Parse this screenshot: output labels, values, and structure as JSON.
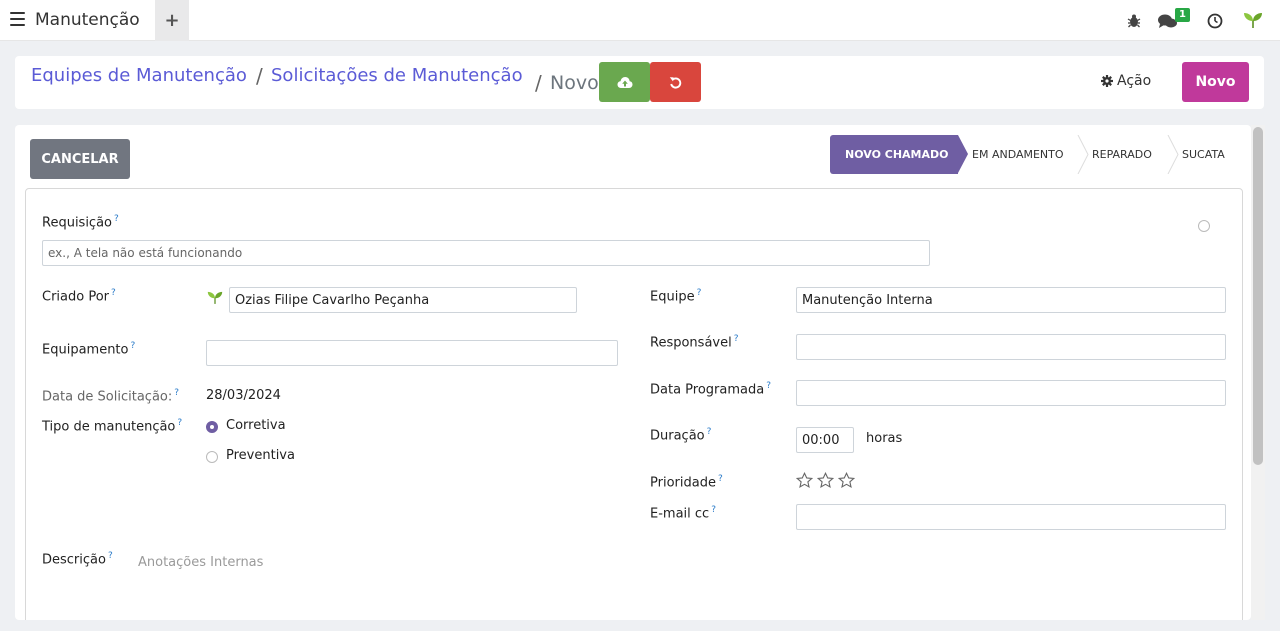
{
  "topbar": {
    "app_title": "Manutenção",
    "plus": "+",
    "chat_badge": "1"
  },
  "breadcrumb": {
    "item1": "Equipes de Manutenção",
    "sep": "/",
    "item2": "Solicitações de Manutenção",
    "current": "Novo"
  },
  "control_panel": {
    "acao_label": "Ação",
    "novo_label": "Novo"
  },
  "form": {
    "cancel_label": "CANCELAR",
    "stages": [
      "NOVO CHAMADO",
      "EM ANDAMENTO",
      "REPARADO",
      "SUCATA"
    ],
    "active_stage": "NOVO CHAMADO",
    "requisicao_label": "Requisição",
    "requisicao_placeholder": "ex., A tela não está funcionando",
    "criado_por_label": "Criado Por",
    "criado_por_value": "Ozias Filipe Cavarlho Peçanha",
    "equipamento_label": "Equipamento",
    "equipamento_value": "",
    "data_solicitacao_label": "Data de Solicitação:",
    "data_solicitacao_value": "28/03/2024",
    "tipo_label": "Tipo de manutenção",
    "tipo_options": [
      "Corretiva",
      "Preventiva"
    ],
    "tipo_selected": "Corretiva",
    "equipe_label": "Equipe",
    "equipe_value": "Manutenção Interna",
    "responsavel_label": "Responsável",
    "responsavel_value": "",
    "data_programada_label": "Data Programada",
    "data_programada_value": "",
    "duracao_label": "Duração",
    "duracao_value": "00:00",
    "duracao_unit": "horas",
    "prioridade_label": "Prioridade",
    "prioridade_stars": 0,
    "prioridade_max": 3,
    "email_cc_label": "E-mail cc",
    "email_cc_value": "",
    "descricao_label": "Descrição",
    "descricao_placeholder": "Anotações Internas",
    "help_mark": "?"
  },
  "colors": {
    "accent_purple": "#6f5ea3",
    "save_green": "#6aa84f",
    "discard_red": "#d9463d",
    "new_magenta": "#c0399b",
    "link_blue": "#5b5bd6"
  },
  "icons": [
    "menu-icon",
    "bug-icon",
    "chat-icon",
    "clock-icon",
    "leaf-icon",
    "cloud-upload-icon",
    "undo-icon",
    "gear-icon",
    "star-icon"
  ]
}
